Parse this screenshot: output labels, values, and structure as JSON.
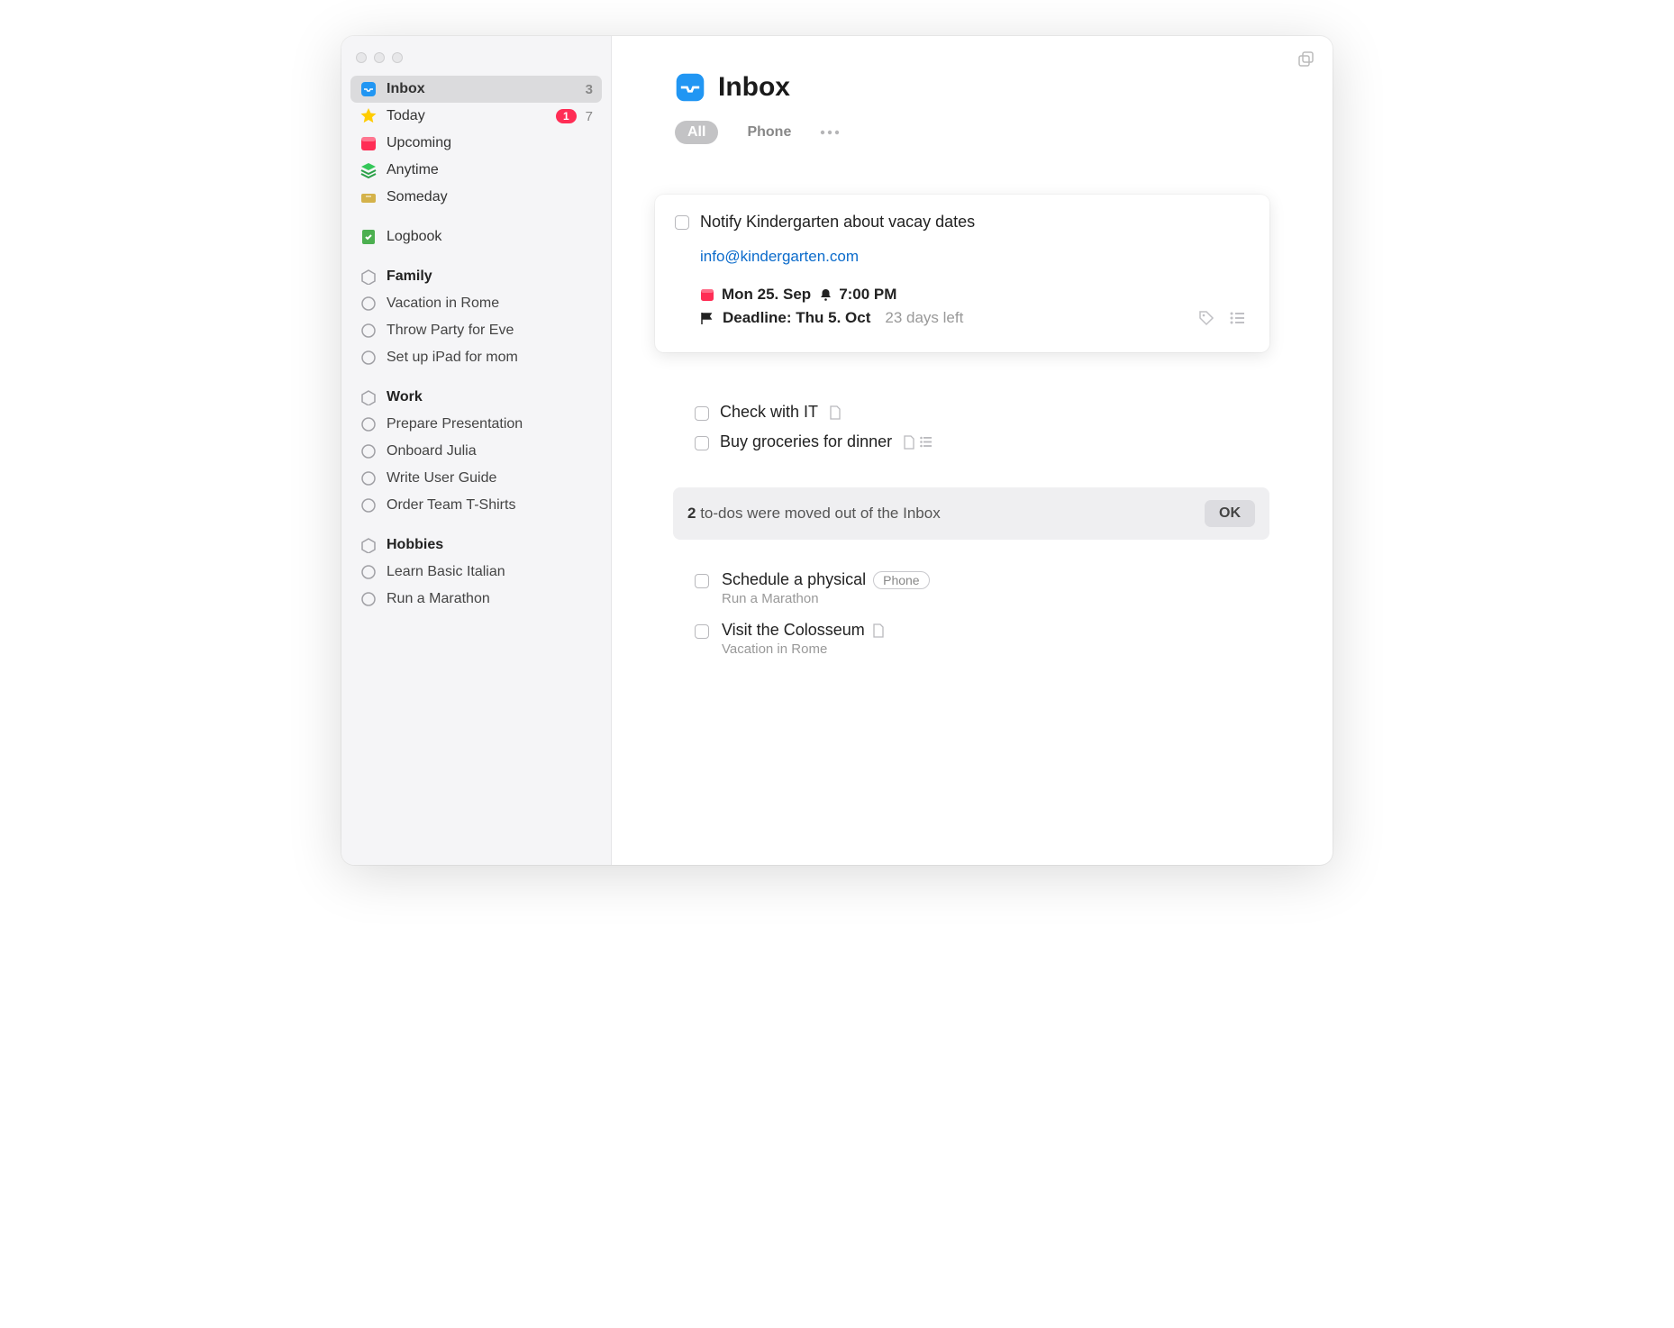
{
  "header": {
    "title": "Inbox"
  },
  "sidebar": {
    "main": [
      {
        "label": "Inbox",
        "icon": "inbox",
        "count": "3",
        "selected": true
      },
      {
        "label": "Today",
        "icon": "star",
        "badge": "1",
        "count": "7"
      },
      {
        "label": "Upcoming",
        "icon": "calendar"
      },
      {
        "label": "Anytime",
        "icon": "stack"
      },
      {
        "label": "Someday",
        "icon": "drawer"
      }
    ],
    "logbook": {
      "label": "Logbook"
    },
    "areas": [
      {
        "name": "Family",
        "projects": [
          "Vacation in Rome",
          "Throw Party for Eve",
          "Set up iPad for mom"
        ]
      },
      {
        "name": "Work",
        "projects": [
          "Prepare Presentation",
          "Onboard Julia",
          "Write User Guide",
          "Order Team T-Shirts"
        ]
      },
      {
        "name": "Hobbies",
        "projects": [
          "Learn Basic Italian",
          "Run a Marathon"
        ]
      }
    ]
  },
  "filters": {
    "all": "All",
    "phone": "Phone"
  },
  "card": {
    "title": "Notify Kindergarten about vacay dates",
    "note": "info@kindergarten.com",
    "date": "Mon 25. Sep",
    "reminder": "7:00 PM",
    "deadline_label": "Deadline: Thu 5. Oct",
    "days_left": "23 days left"
  },
  "tasks": [
    {
      "title": "Check with IT",
      "has_note": true,
      "has_checklist": false
    },
    {
      "title": "Buy groceries for dinner",
      "has_note": true,
      "has_checklist": true
    }
  ],
  "moved_bar": {
    "count": "2",
    "text": "to-dos were moved out of the Inbox",
    "ok": "OK"
  },
  "moved": [
    {
      "title": "Schedule a physical",
      "tag": "Phone",
      "subtitle": "Run a Marathon",
      "has_note": false
    },
    {
      "title": "Visit the Colosseum",
      "tag": null,
      "subtitle": "Vacation in Rome",
      "has_note": true
    }
  ]
}
